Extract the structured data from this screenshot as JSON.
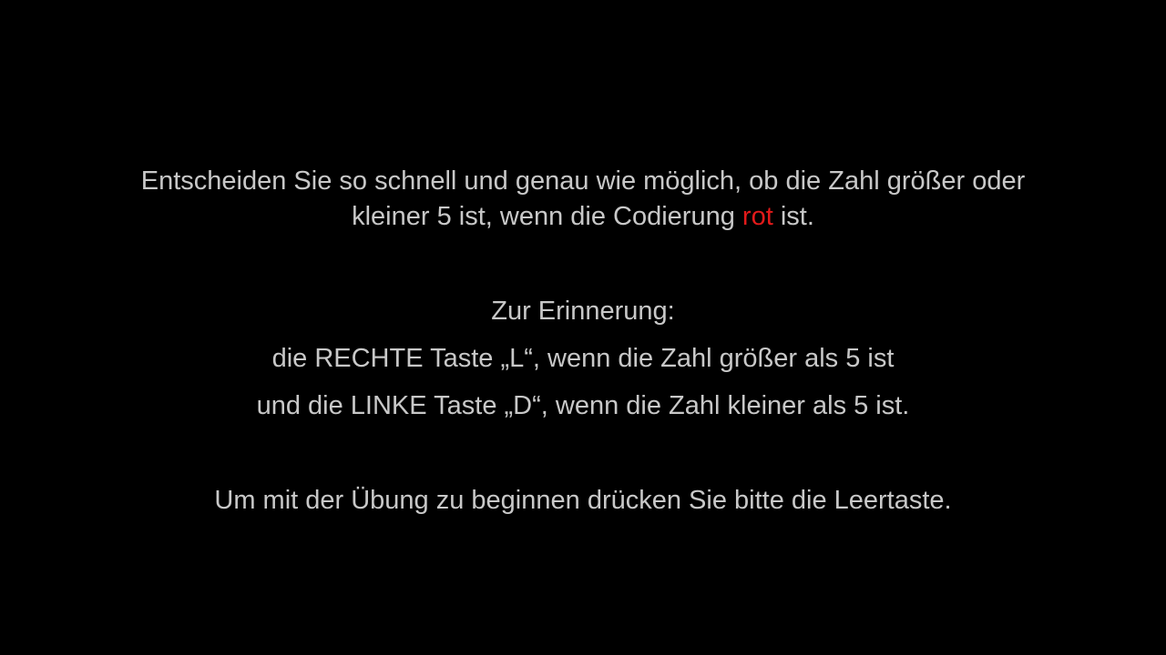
{
  "instructions": {
    "paragraph1_line1": "Entscheiden Sie so schnell und genau wie möglich, ob die Zahl größer oder",
    "paragraph1_line2_before": "kleiner 5 ist, wenn die Codierung ",
    "paragraph1_line2_highlight": "rot",
    "paragraph1_line2_after": " ist.",
    "reminder_heading": "Zur Erinnerung:",
    "reminder_right_key": "die RECHTE Taste „L“, wenn die Zahl größer als 5 ist",
    "reminder_left_key": "und die LINKE Taste „D“, wenn die Zahl kleiner als 5 ist.",
    "start_prompt": "Um mit der Übung zu beginnen drücken Sie bitte die Leertaste."
  },
  "colors": {
    "background": "#000000",
    "text": "#c8c8c8",
    "highlight": "#e21a1a"
  }
}
